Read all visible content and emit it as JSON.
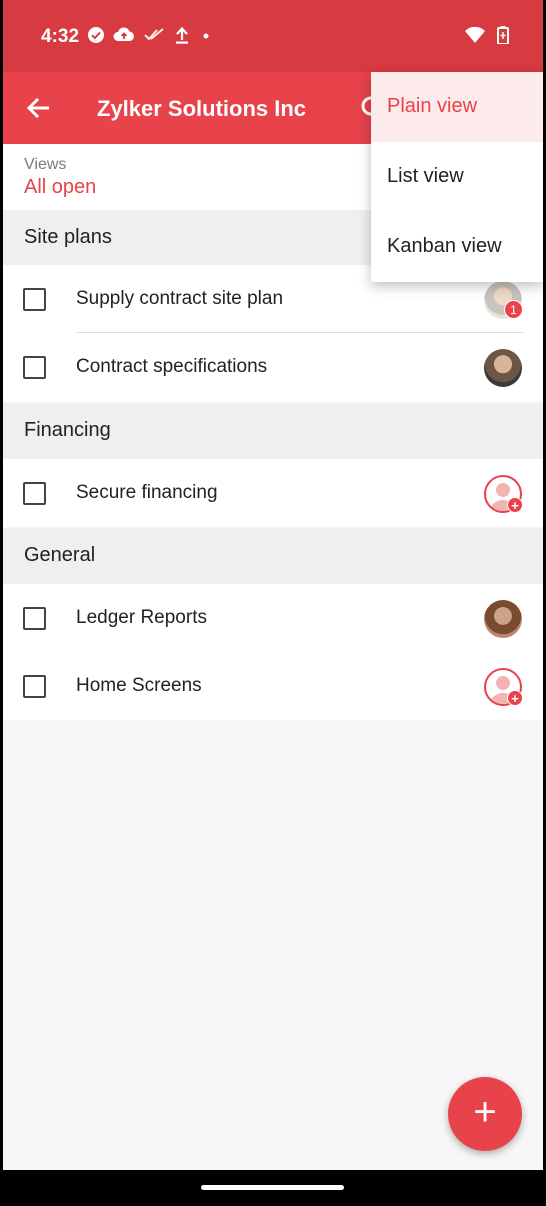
{
  "status": {
    "time": "4:32"
  },
  "appbar": {
    "title": "Zylker Solutions Inc"
  },
  "views": {
    "label": "Views",
    "value": "All open"
  },
  "menu": {
    "items": [
      "Plain view",
      "List view",
      "Kanban view"
    ],
    "selected": "Plain view"
  },
  "sections": [
    {
      "title": "Site plans",
      "tasks": [
        {
          "name": "Supply contract site plan",
          "assignee": "photo",
          "badge": "1"
        },
        {
          "name": "Contract specifications",
          "assignee": "photo"
        }
      ]
    },
    {
      "title": "Financing",
      "tasks": [
        {
          "name": "Secure financing",
          "assignee": "add-user"
        }
      ]
    },
    {
      "title": "General",
      "tasks": [
        {
          "name": "Ledger Reports",
          "assignee": "photo"
        },
        {
          "name": "Home Screens",
          "assignee": "add-user"
        }
      ]
    }
  ],
  "colors": {
    "accent": "#e8424a",
    "statusbar": "#d73a40"
  },
  "fab": {
    "label": "+"
  }
}
